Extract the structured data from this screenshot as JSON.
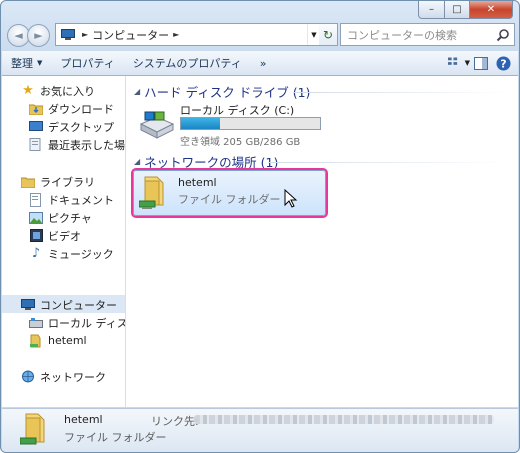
{
  "window": {
    "caption_buttons": {
      "minimize": "–",
      "maximize": "□",
      "close": "✕"
    }
  },
  "nav": {
    "back_glyph": "◄",
    "forward_glyph": "►",
    "address_segments": [
      "コンピューター"
    ],
    "search_placeholder": "コンピューターの検索"
  },
  "toolbar": {
    "items": [
      "整理",
      "プロパティ",
      "システムのプロパティ",
      "»"
    ]
  },
  "sidebar": {
    "favorites": {
      "label": "お気に入り",
      "items": [
        "ダウンロード",
        "デスクトップ",
        "最近表示した場所"
      ]
    },
    "libraries": {
      "label": "ライブラリ",
      "items": [
        "ドキュメント",
        "ピクチャ",
        "ビデオ",
        "ミュージック"
      ]
    },
    "computer": {
      "label": "コンピューター",
      "items": [
        "ローカル ディスク (C:)",
        "heteml"
      ]
    },
    "network": {
      "label": "ネットワーク"
    }
  },
  "content": {
    "hdd_group": "ハード ディスク ドライブ (1)",
    "drive": {
      "name": "ローカル ディスク (C:)",
      "free_text": "空き領域 205 GB/286 GB",
      "used_fraction": 0.283
    },
    "net_group": "ネットワークの場所 (1)",
    "net_item": {
      "name": "heteml",
      "type": "ファイル フォルダー"
    }
  },
  "details": {
    "name": "heteml",
    "type": "ファイル フォルダー",
    "link_label": "リンク先:"
  },
  "colors": {
    "selection_outline": "#e8379b",
    "drive_bar": "#1a86c6",
    "group_header": "#1e3287"
  }
}
